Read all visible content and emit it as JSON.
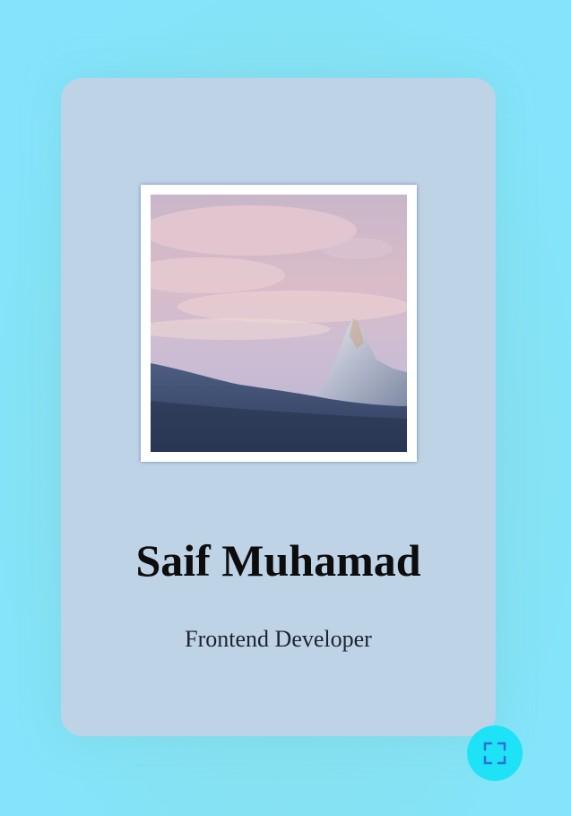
{
  "profile": {
    "name": "Saif Muhamad",
    "role": "Frontend Developer"
  },
  "photo": {
    "subject": "snowy mountain peak at dusk"
  },
  "fullscreen_button": {
    "icon": "fullscreen-icon"
  },
  "colors": {
    "page_background": "#84e4fb",
    "card_background": "#bfd3e7",
    "button_background": "#1ee2f6",
    "icon_color": "#2f6fd6"
  }
}
